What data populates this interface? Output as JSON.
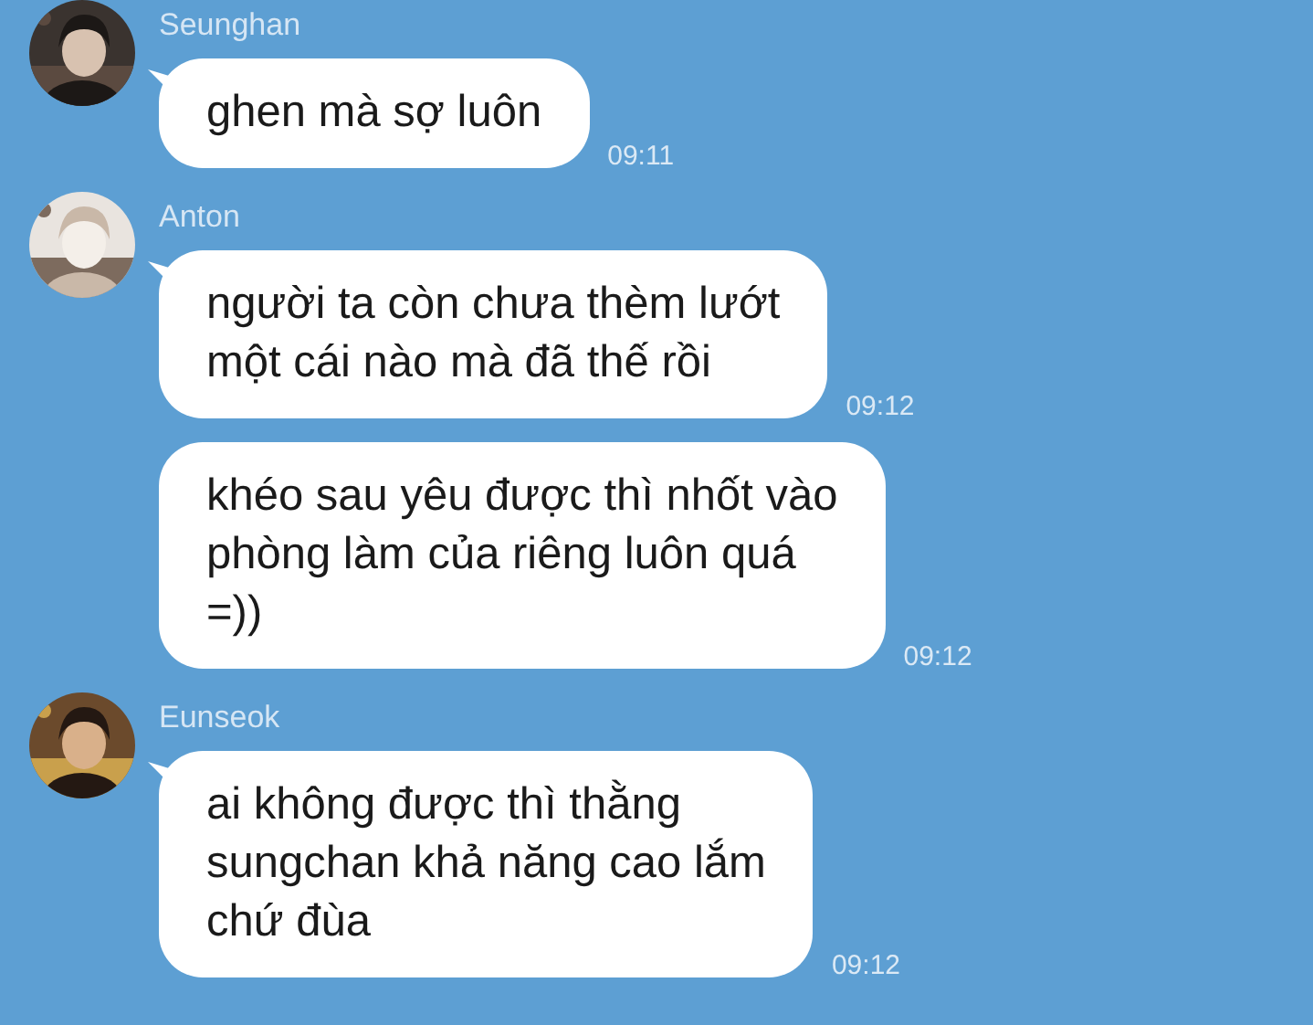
{
  "messages": [
    {
      "sender": "Seunghan",
      "bubbles": [
        {
          "text": "ghen mà sợ luôn",
          "time": "09:11"
        }
      ]
    },
    {
      "sender": "Anton",
      "bubbles": [
        {
          "text": "người ta còn chưa thèm lướt\nmột cái nào mà đã thế rồi",
          "time": "09:12"
        },
        {
          "text": "khéo sau yêu được thì nhốt vào\nphòng làm của riêng luôn quá\n=))",
          "time": "09:12"
        }
      ]
    },
    {
      "sender": "Eunseok",
      "bubbles": [
        {
          "text": "ai không được thì thằng\nsungchan khả năng cao lắm\nchứ đùa",
          "time": "09:12"
        }
      ]
    }
  ]
}
